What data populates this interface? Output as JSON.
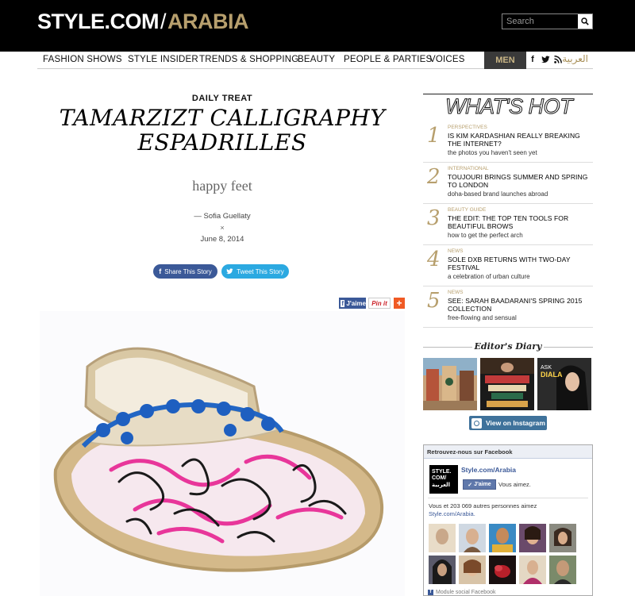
{
  "header": {
    "logo_part1": "STYLE.COM",
    "logo_sep": "/",
    "logo_part2": "ARABIA",
    "search_placeholder": "Search"
  },
  "nav": {
    "items": [
      "FASHION SHOWS",
      "STYLE INSIDER",
      "TRENDS & SHOPPING",
      "BEAUTY",
      "PEOPLE & PARTIES",
      "VOICES"
    ],
    "men_label": "MEN",
    "arabic_label": "العربية"
  },
  "article": {
    "kicker": "DAILY TREAT",
    "headline_line1": "TAMARZIZT CALLIGRAPHY",
    "headline_line2": "ESPADRILLES",
    "subhead": "happy feet",
    "byline": "— Sofia Guellaty",
    "byline_sep": "×",
    "date": "June 8, 2014",
    "share_facebook": "Share This Story",
    "share_twitter": "Tweet This Story",
    "like_label": "J'aime",
    "pin_label": "Pin it",
    "plus_label": "+"
  },
  "whats_hot": {
    "title": "WHAT'S HOT",
    "items": [
      {
        "num": "1",
        "category": "PERSPECTIVES",
        "headline": "IS KIM KARDASHIAN REALLY BREAKING THE INTERNET?",
        "sub": "the photos you haven't seen yet"
      },
      {
        "num": "2",
        "category": "INTERNATIONAL",
        "headline": "TOUJOURI BRINGS SUMMER AND SPRING TO LONDON",
        "sub": "doha-based brand launches abroad"
      },
      {
        "num": "3",
        "category": "BEAUTY GUIDE",
        "headline": "THE EDIT: THE TOP TEN TOOLS FOR BEAUTIFUL BROWS",
        "sub": "how to get the perfect arch"
      },
      {
        "num": "4",
        "category": "NEWS",
        "headline": "SOLE DXB RETURNS WITH TWO-DAY FESTIVAL",
        "sub": "a celebration of urban culture"
      },
      {
        "num": "5",
        "category": "NEWS",
        "headline": "SEE: SARAH BAADARANI'S SPRING 2015 COLLECTION",
        "sub": "free-flowing and sensual"
      }
    ]
  },
  "editors_diary": {
    "title": "Editor's Diary",
    "instagram_button": "View on Instagram"
  },
  "facebook_box": {
    "title": "Retrouvez-nous sur Facebook",
    "logo_line1": "STYLE.",
    "logo_line2": "COM/",
    "logo_line3": "العربية",
    "page_name": "Style.com/Arabia",
    "like_button": "J'aime",
    "like_status": "Vous aimez.",
    "fans_text": "Vous et 203 069 autres personnes aimez",
    "fans_link": "Style.com/Arabia.",
    "footer": "Module social Facebook"
  },
  "colors": {
    "gold": "#b79f6d",
    "facebook": "#3b5998",
    "twitter": "#2ba9e1",
    "instagram": "#3f729b"
  }
}
